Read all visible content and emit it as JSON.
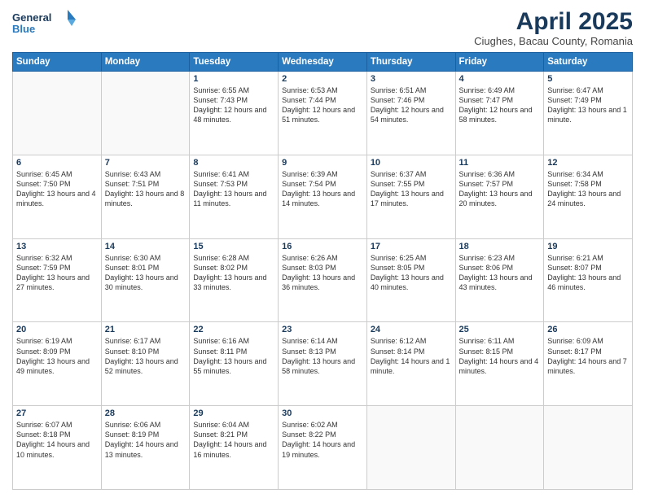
{
  "header": {
    "logo_line1": "General",
    "logo_line2": "Blue",
    "main_title": "April 2025",
    "subtitle": "Ciughes, Bacau County, Romania"
  },
  "days_of_week": [
    "Sunday",
    "Monday",
    "Tuesday",
    "Wednesday",
    "Thursday",
    "Friday",
    "Saturday"
  ],
  "weeks": [
    [
      {
        "day": "",
        "info": ""
      },
      {
        "day": "",
        "info": ""
      },
      {
        "day": "1",
        "info": "Sunrise: 6:55 AM\nSunset: 7:43 PM\nDaylight: 12 hours and 48 minutes."
      },
      {
        "day": "2",
        "info": "Sunrise: 6:53 AM\nSunset: 7:44 PM\nDaylight: 12 hours and 51 minutes."
      },
      {
        "day": "3",
        "info": "Sunrise: 6:51 AM\nSunset: 7:46 PM\nDaylight: 12 hours and 54 minutes."
      },
      {
        "day": "4",
        "info": "Sunrise: 6:49 AM\nSunset: 7:47 PM\nDaylight: 12 hours and 58 minutes."
      },
      {
        "day": "5",
        "info": "Sunrise: 6:47 AM\nSunset: 7:49 PM\nDaylight: 13 hours and 1 minute."
      }
    ],
    [
      {
        "day": "6",
        "info": "Sunrise: 6:45 AM\nSunset: 7:50 PM\nDaylight: 13 hours and 4 minutes."
      },
      {
        "day": "7",
        "info": "Sunrise: 6:43 AM\nSunset: 7:51 PM\nDaylight: 13 hours and 8 minutes."
      },
      {
        "day": "8",
        "info": "Sunrise: 6:41 AM\nSunset: 7:53 PM\nDaylight: 13 hours and 11 minutes."
      },
      {
        "day": "9",
        "info": "Sunrise: 6:39 AM\nSunset: 7:54 PM\nDaylight: 13 hours and 14 minutes."
      },
      {
        "day": "10",
        "info": "Sunrise: 6:37 AM\nSunset: 7:55 PM\nDaylight: 13 hours and 17 minutes."
      },
      {
        "day": "11",
        "info": "Sunrise: 6:36 AM\nSunset: 7:57 PM\nDaylight: 13 hours and 20 minutes."
      },
      {
        "day": "12",
        "info": "Sunrise: 6:34 AM\nSunset: 7:58 PM\nDaylight: 13 hours and 24 minutes."
      }
    ],
    [
      {
        "day": "13",
        "info": "Sunrise: 6:32 AM\nSunset: 7:59 PM\nDaylight: 13 hours and 27 minutes."
      },
      {
        "day": "14",
        "info": "Sunrise: 6:30 AM\nSunset: 8:01 PM\nDaylight: 13 hours and 30 minutes."
      },
      {
        "day": "15",
        "info": "Sunrise: 6:28 AM\nSunset: 8:02 PM\nDaylight: 13 hours and 33 minutes."
      },
      {
        "day": "16",
        "info": "Sunrise: 6:26 AM\nSunset: 8:03 PM\nDaylight: 13 hours and 36 minutes."
      },
      {
        "day": "17",
        "info": "Sunrise: 6:25 AM\nSunset: 8:05 PM\nDaylight: 13 hours and 40 minutes."
      },
      {
        "day": "18",
        "info": "Sunrise: 6:23 AM\nSunset: 8:06 PM\nDaylight: 13 hours and 43 minutes."
      },
      {
        "day": "19",
        "info": "Sunrise: 6:21 AM\nSunset: 8:07 PM\nDaylight: 13 hours and 46 minutes."
      }
    ],
    [
      {
        "day": "20",
        "info": "Sunrise: 6:19 AM\nSunset: 8:09 PM\nDaylight: 13 hours and 49 minutes."
      },
      {
        "day": "21",
        "info": "Sunrise: 6:17 AM\nSunset: 8:10 PM\nDaylight: 13 hours and 52 minutes."
      },
      {
        "day": "22",
        "info": "Sunrise: 6:16 AM\nSunset: 8:11 PM\nDaylight: 13 hours and 55 minutes."
      },
      {
        "day": "23",
        "info": "Sunrise: 6:14 AM\nSunset: 8:13 PM\nDaylight: 13 hours and 58 minutes."
      },
      {
        "day": "24",
        "info": "Sunrise: 6:12 AM\nSunset: 8:14 PM\nDaylight: 14 hours and 1 minute."
      },
      {
        "day": "25",
        "info": "Sunrise: 6:11 AM\nSunset: 8:15 PM\nDaylight: 14 hours and 4 minutes."
      },
      {
        "day": "26",
        "info": "Sunrise: 6:09 AM\nSunset: 8:17 PM\nDaylight: 14 hours and 7 minutes."
      }
    ],
    [
      {
        "day": "27",
        "info": "Sunrise: 6:07 AM\nSunset: 8:18 PM\nDaylight: 14 hours and 10 minutes."
      },
      {
        "day": "28",
        "info": "Sunrise: 6:06 AM\nSunset: 8:19 PM\nDaylight: 14 hours and 13 minutes."
      },
      {
        "day": "29",
        "info": "Sunrise: 6:04 AM\nSunset: 8:21 PM\nDaylight: 14 hours and 16 minutes."
      },
      {
        "day": "30",
        "info": "Sunrise: 6:02 AM\nSunset: 8:22 PM\nDaylight: 14 hours and 19 minutes."
      },
      {
        "day": "",
        "info": ""
      },
      {
        "day": "",
        "info": ""
      },
      {
        "day": "",
        "info": ""
      }
    ]
  ]
}
